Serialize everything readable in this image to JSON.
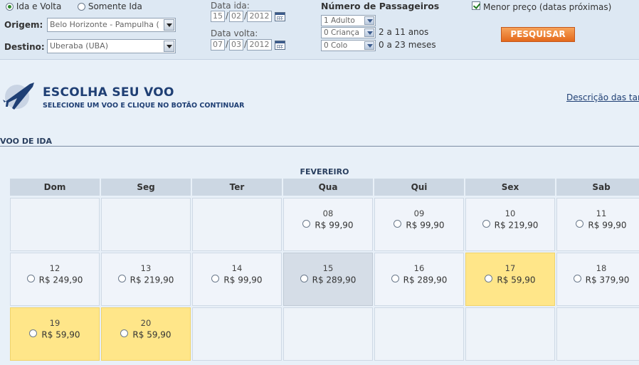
{
  "search": {
    "trip_round": "Ida e Volta",
    "trip_oneway": "Somente Ida",
    "origin_label": "Origem:",
    "origin_value": "Belo Horizonte - Pampulha (",
    "destination_label": "Destino:",
    "destination_value": "Uberaba (UBA)",
    "date_out_label": "Data ida:",
    "date_out": {
      "day": "15",
      "month": "02",
      "year": "2012"
    },
    "date_back_label": "Data volta:",
    "date_back": {
      "day": "07",
      "month": "03",
      "year": "2012"
    },
    "passengers_label": "Número de Passageiros",
    "adults_value": "1 Adulto",
    "children_value": "0 Criança",
    "children_hint": "2 a 11 anos",
    "infants_value": "0 Colo",
    "infants_hint": "0 a 23 meses",
    "lowest_price_label": "Menor preço (datas próximas)",
    "search_button": "PESQUISAR"
  },
  "header": {
    "title": "ESCOLHA SEU VOO",
    "subtitle": "SELECIONE UM VOO E CLIQUE NO BOTÃO CONTINUAR",
    "tariff_link": "Descrição das tari"
  },
  "section": {
    "label": "VOO DE IDA"
  },
  "calendar": {
    "month": "FEVEREIRO",
    "weekdays": [
      "Dom",
      "Seg",
      "Ter",
      "Qua",
      "Qui",
      "Sex",
      "Sab"
    ],
    "days": [
      {
        "day": "",
        "price": "",
        "state": "empty"
      },
      {
        "day": "",
        "price": "",
        "state": "empty"
      },
      {
        "day": "",
        "price": "",
        "state": "empty"
      },
      {
        "day": "08",
        "price": "R$ 99,90",
        "state": "normal"
      },
      {
        "day": "09",
        "price": "R$ 99,90",
        "state": "normal"
      },
      {
        "day": "10",
        "price": "R$ 219,90",
        "state": "normal"
      },
      {
        "day": "11",
        "price": "R$ 99,90",
        "state": "normal"
      },
      {
        "day": "12",
        "price": "R$ 249,90",
        "state": "normal"
      },
      {
        "day": "13",
        "price": "R$ 219,90",
        "state": "normal"
      },
      {
        "day": "14",
        "price": "R$ 99,90",
        "state": "normal"
      },
      {
        "day": "15",
        "price": "R$ 289,90",
        "state": "selected"
      },
      {
        "day": "16",
        "price": "R$ 289,90",
        "state": "normal"
      },
      {
        "day": "17",
        "price": "R$ 59,90",
        "state": "cheap"
      },
      {
        "day": "18",
        "price": "R$ 379,90",
        "state": "normal"
      },
      {
        "day": "19",
        "price": "R$ 59,90",
        "state": "cheap"
      },
      {
        "day": "20",
        "price": "R$ 59,90",
        "state": "cheap"
      },
      {
        "day": "",
        "price": "",
        "state": "empty"
      },
      {
        "day": "",
        "price": "",
        "state": "empty"
      },
      {
        "day": "",
        "price": "",
        "state": "empty"
      },
      {
        "day": "",
        "price": "",
        "state": "empty"
      },
      {
        "day": "",
        "price": "",
        "state": "empty"
      }
    ]
  },
  "colors": {
    "accent": "#1f3f74",
    "cheap_highlight": "#ffe689",
    "search_button": "#e4691c"
  }
}
